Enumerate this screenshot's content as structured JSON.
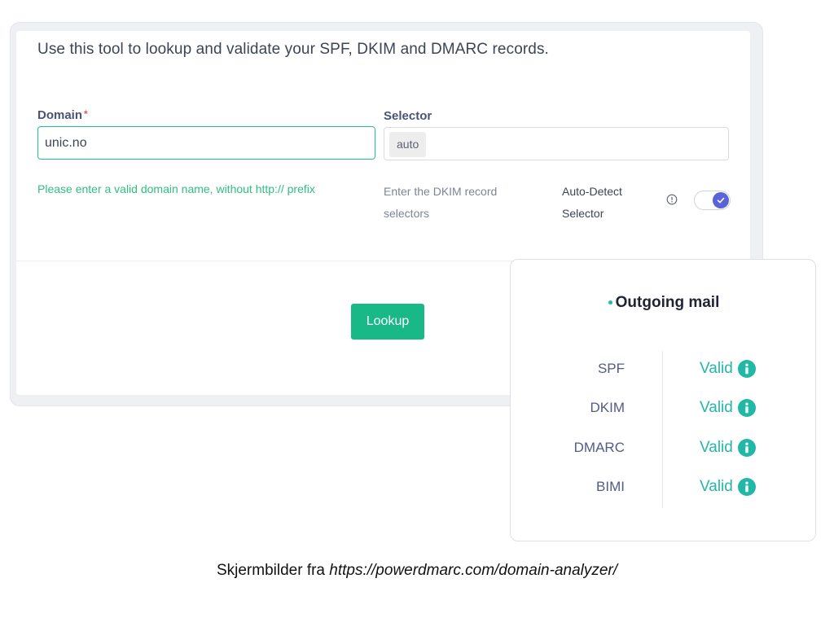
{
  "form": {
    "intro": "Use this tool to lookup and validate your SPF, DKIM and DMARC records.",
    "domain_label": "Domain",
    "required_mark": "*",
    "domain_value": "unic.no",
    "domain_hint": "Please enter a valid domain name, without http:// prefix",
    "selector_label": "Selector",
    "selector_chip": "auto",
    "selector_hint": "Enter the DKIM record selectors",
    "auto_detect_label": "Auto-Detect Selector",
    "auto_detect_enabled": true,
    "lookup_button": "Lookup"
  },
  "results": {
    "title": "Outgoing mail",
    "records": [
      {
        "name": "SPF",
        "status": "Valid"
      },
      {
        "name": "DKIM",
        "status": "Valid"
      },
      {
        "name": "DMARC",
        "status": "Valid"
      },
      {
        "name": "BIMI",
        "status": "Valid"
      }
    ]
  },
  "caption": {
    "prefix": "Skjermbilder fra ",
    "url": "https://powerdmarc.com/domain-analyzer/"
  },
  "colors": {
    "accent_green": "#19b987",
    "valid_teal": "#22b8a6",
    "toggle_blue": "#5b63d8",
    "required_red": "#e05757"
  },
  "icons": {
    "info_outline": "info-outline-icon",
    "info_filled": "info-filled-icon",
    "check": "check-icon"
  }
}
